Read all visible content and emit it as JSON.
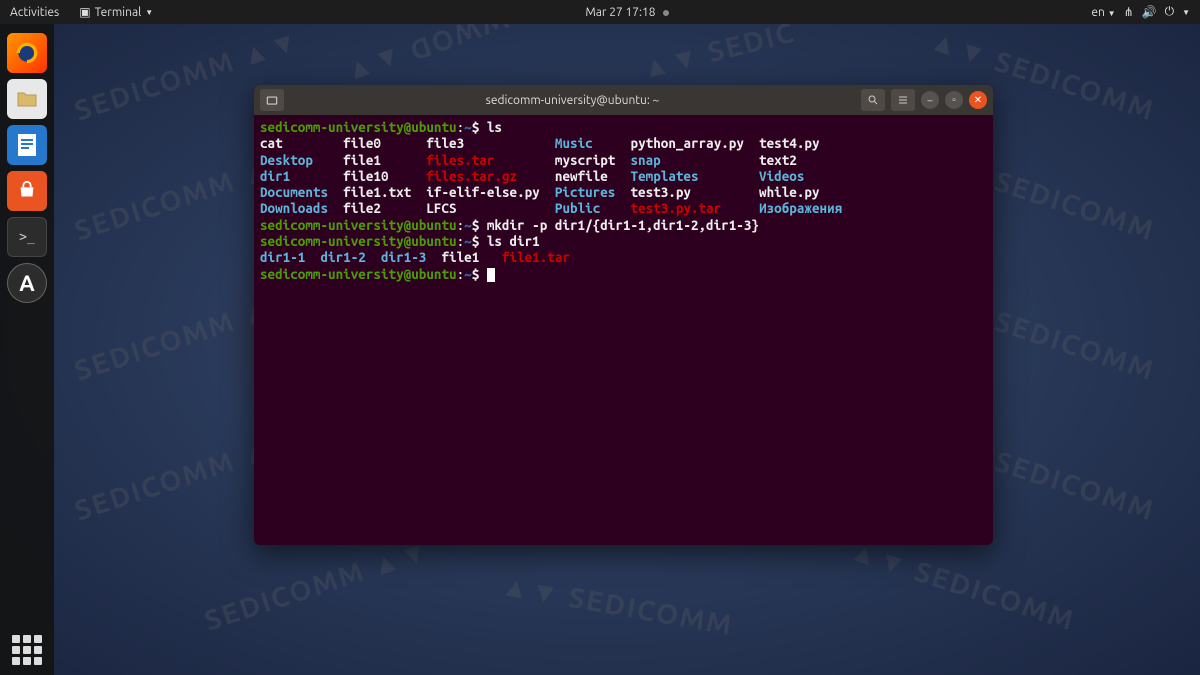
{
  "topbar": {
    "activities": "Activities",
    "terminal_label": "Terminal",
    "datetime": "Mar 27  17:18",
    "lang": "en"
  },
  "window": {
    "title": "sedicomm-university@ubuntu: ~"
  },
  "prompt": {
    "userhost": "sedicomm-university@ubuntu",
    "path": "~",
    "sym": "$"
  },
  "commands": {
    "ls": "ls",
    "mkdir": "mkdir -p dir1/{dir1-1,dir1-2,dir1-3}",
    "lsdir1": "ls dir1"
  },
  "ls_cols": {
    "c1": [
      "cat",
      "Desktop",
      "dir1",
      "Documents",
      "Downloads"
    ],
    "c2": [
      "file0",
      "file1",
      "file10",
      "file1.txt",
      "file2"
    ],
    "c3": [
      "file3",
      "files.tar",
      "files.tar.gz",
      "if-elif-else.py",
      "LFCS"
    ],
    "c4": [
      "Music",
      "myscript",
      "newfile",
      "Pictures",
      "Public"
    ],
    "c5": [
      "python_array.py",
      "snap",
      "Templates",
      "test3.py",
      "test3.py.tar"
    ],
    "c6": [
      "test4.py",
      "text2",
      "Videos",
      "while.py",
      "Изображения"
    ]
  },
  "ls_dir1": [
    "dir1-1",
    "dir1-2",
    "dir1-3",
    "file1",
    "file1.tar"
  ]
}
